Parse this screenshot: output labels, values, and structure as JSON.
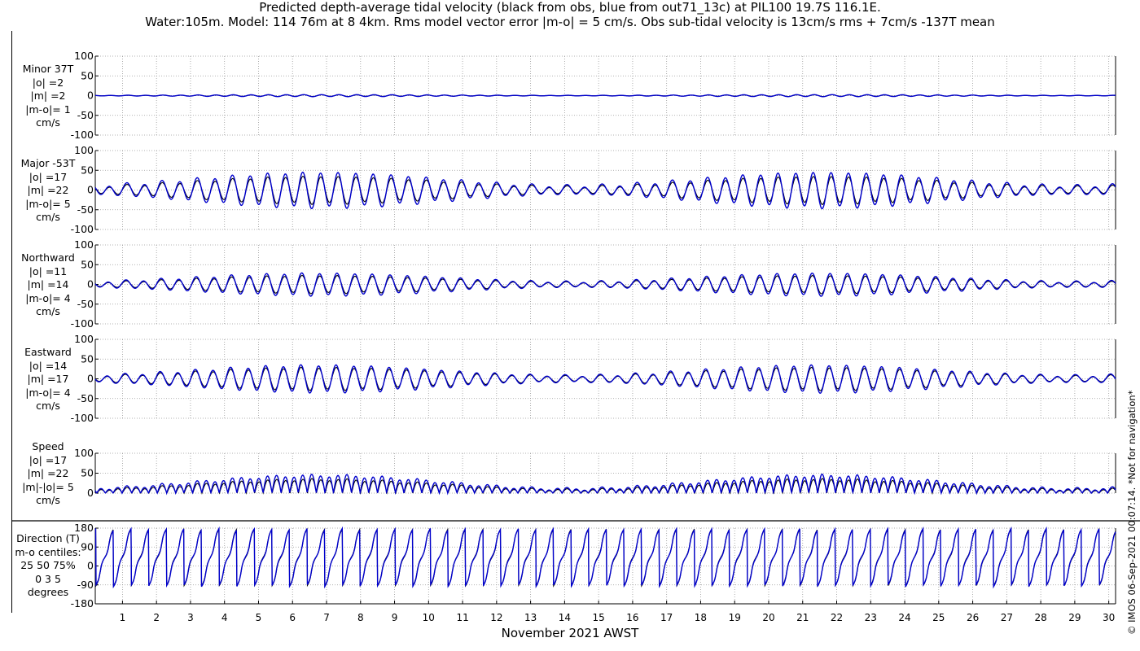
{
  "title_line1": "Predicted depth-average tidal velocity (black from obs, blue from out71_13c) at PIL100 19.7S 116.1E.",
  "title_line2": "Water:105m. Model: 114 76m at 8 4km. Rms model vector error |m-o| = 5 cm/s. Obs sub-tidal velocity is 13cm/s rms + 7cm/s -137T mean",
  "copyright": "© IMOS 06-Sep-2021 00:07:14. *Not for navigation*",
  "colors": {
    "obs": "#000000",
    "model": "#0000cc",
    "grid": "#999999"
  },
  "chart_data": {
    "type": "line",
    "xlabel": "November 2021 AWST",
    "x_ticks": [
      1,
      2,
      3,
      4,
      5,
      6,
      7,
      8,
      9,
      10,
      11,
      12,
      13,
      14,
      15,
      16,
      17,
      18,
      19,
      20,
      21,
      22,
      23,
      24,
      25,
      26,
      27,
      28,
      29,
      30
    ],
    "xlim": [
      0.2,
      30.2
    ],
    "series_names": [
      "obs",
      "model"
    ],
    "panels": [
      {
        "id": "minor",
        "label": [
          "Minor 37T",
          "|o| =2",
          "|m| =2",
          "|m-o|= 1",
          "cm/s"
        ],
        "ylim": [
          -100,
          100
        ],
        "yticks": [
          100,
          50,
          0,
          -50,
          -100
        ],
        "amp_obs": 2,
        "amp_model": 2.5,
        "kind": "velocity"
      },
      {
        "id": "major",
        "label": [
          "Major -53T",
          "|o| =17",
          "|m| =22",
          "|m-o|= 5",
          "cm/s"
        ],
        "ylim": [
          -100,
          100
        ],
        "yticks": [
          100,
          50,
          0,
          -50,
          -100
        ],
        "amp_obs": 17,
        "amp_model": 22,
        "kind": "velocity"
      },
      {
        "id": "northward",
        "label": [
          "Northward",
          "|o| =11",
          "|m| =14",
          "|m-o|= 4",
          "cm/s"
        ],
        "ylim": [
          -100,
          100
        ],
        "yticks": [
          100,
          50,
          0,
          -50,
          -100
        ],
        "amp_obs": 11,
        "amp_model": 14,
        "kind": "velocity"
      },
      {
        "id": "eastward",
        "label": [
          "Eastward",
          "|o| =14",
          "|m| =17",
          "|m-o|= 4",
          "cm/s"
        ],
        "ylim": [
          -100,
          100
        ],
        "yticks": [
          100,
          50,
          0,
          -50,
          -100
        ],
        "amp_obs": 14,
        "amp_model": 17,
        "kind": "velocity"
      },
      {
        "id": "speed",
        "label": [
          "Speed",
          "|o| =17",
          "|m| =22",
          "|m|-|o|= 5",
          "cm/s"
        ],
        "ylim": [
          0,
          100
        ],
        "yticks": [
          100,
          50,
          0
        ],
        "amp_obs": 17,
        "amp_model": 22,
        "kind": "speed"
      },
      {
        "id": "direction",
        "label": [
          "Direction (T)",
          "m-o centiles:",
          "25  50  75%",
          "0  3  5",
          "degrees"
        ],
        "ylim": [
          -180,
          180
        ],
        "yticks": [
          180,
          90,
          0,
          -90,
          -180
        ],
        "kind": "direction"
      }
    ]
  }
}
